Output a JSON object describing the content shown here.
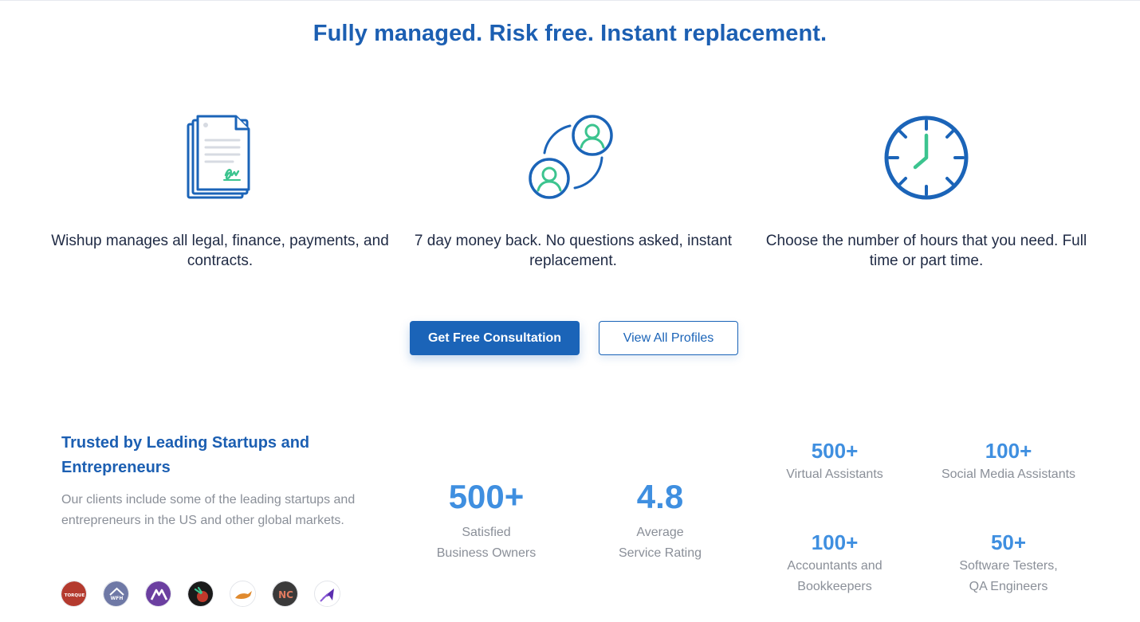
{
  "headline": "Fully managed. Risk free. Instant replacement.",
  "features": [
    {
      "icon": "contract-documents-icon",
      "text": "Wishup manages all legal, finance, payments, and contracts."
    },
    {
      "icon": "replacement-users-icon",
      "text": "7 day money back. No questions asked, instant replacement."
    },
    {
      "icon": "clock-icon",
      "text": "Choose the number of hours that you need. Full time or part time."
    }
  ],
  "buttons": {
    "consultation": "Get Free Consultation",
    "profiles": "View All Profiles"
  },
  "trusted": {
    "title": "Trusted by Leading Startups and Entrepreneurs",
    "description": "Our clients include some of the leading startups and entrepreneurs in the US and other global markets."
  },
  "client_logos": [
    {
      "name": "torque-logo",
      "text": "TORQUE",
      "color": "#b43a2e"
    },
    {
      "name": "wfh-logo",
      "text": "WFH",
      "color": "#6f79a6"
    },
    {
      "name": "mountain-logo",
      "text": "",
      "color": "#6b3fa0"
    },
    {
      "name": "berry-logo",
      "text": "",
      "color": "#1a1a1a"
    },
    {
      "name": "rabbit-logo",
      "text": "",
      "color": "#ffffff"
    },
    {
      "name": "nc-logo",
      "text": "NC",
      "color": "#3a3a3a"
    },
    {
      "name": "arrow-logo",
      "text": "",
      "color": "#ffffff"
    }
  ],
  "stats": {
    "owners": {
      "value": "500+",
      "label1": "Satisfied",
      "label2": "Business Owners"
    },
    "rating": {
      "value": "4.8",
      "label1": "Average",
      "label2": "Service Rating"
    },
    "virtual": {
      "value": "500+",
      "label1": "Virtual Assistants"
    },
    "social": {
      "value": "100+",
      "label1": "Social Media Assistants"
    },
    "accountants": {
      "value": "100+",
      "label1": "Accountants and",
      "label2": "Bookkeepers"
    },
    "testers": {
      "value": "50+",
      "label1": "Software Testers,",
      "label2": "QA Engineers"
    }
  },
  "colors": {
    "brand_blue": "#1b64b8",
    "stat_blue": "#3f8fe0",
    "accent_green": "#3cc48f",
    "muted_text": "#8a8f98"
  }
}
